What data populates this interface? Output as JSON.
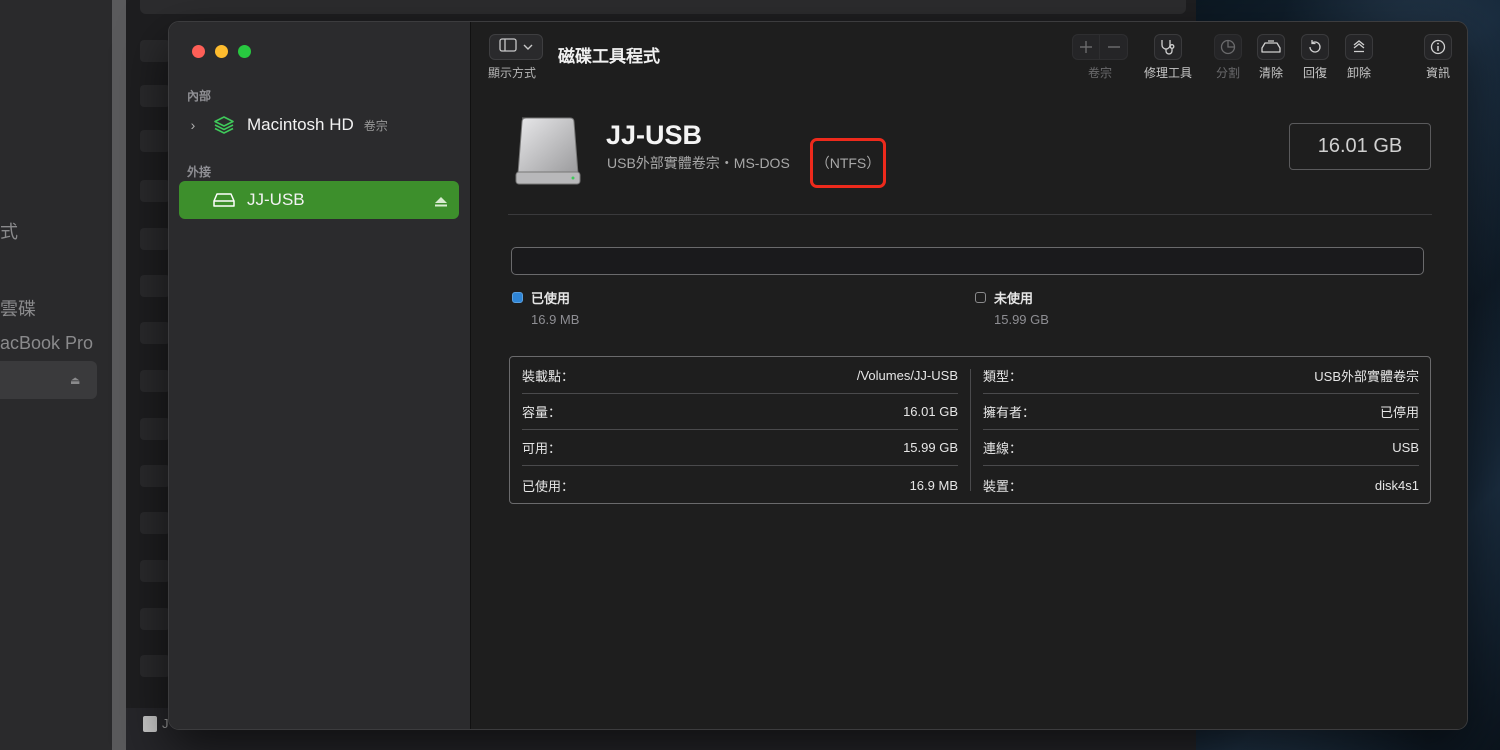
{
  "background": {
    "left_texts": [
      "式",
      "雲碟",
      "acBook Pro"
    ],
    "bottom_text": "J"
  },
  "window": {
    "title": "磁碟工具程式",
    "view_label": "顯示方式",
    "toolbar": {
      "volume": "卷宗",
      "first_aid": "修理工具",
      "partition": "分割",
      "erase": "清除",
      "restore": "回復",
      "unmount": "卸除",
      "info": "資訊"
    }
  },
  "sidebar": {
    "internal_header": "內部",
    "external_header": "外接",
    "items": [
      {
        "label": "Macintosh HD",
        "sub": "卷宗"
      },
      {
        "label": "JJ-USB",
        "sub": ""
      }
    ]
  },
  "volume": {
    "name": "JJ-USB",
    "description": "USB外部實體卷宗・MS-DOS",
    "filesystem": "（NTFS）",
    "capacity": "16.01 GB"
  },
  "usage": {
    "used_label": "已使用",
    "used_value": "16.9 MB",
    "free_label": "未使用",
    "free_value": "15.99 GB",
    "used_fraction": 0.001,
    "colors": {
      "used": "#2f85d6",
      "accent": "#3d8f2c",
      "highlight": "#ee2a1c"
    }
  },
  "info": {
    "left": [
      {
        "key": "裝載點：",
        "value": "/Volumes/JJ-USB"
      },
      {
        "key": "容量：",
        "value": "16.01 GB"
      },
      {
        "key": "可用：",
        "value": "15.99 GB"
      },
      {
        "key": "已使用：",
        "value": "16.9 MB"
      }
    ],
    "right": [
      {
        "key": "類型：",
        "value": "USB外部實體卷宗"
      },
      {
        "key": "擁有者：",
        "value": "已停用"
      },
      {
        "key": "連線：",
        "value": "USB"
      },
      {
        "key": "裝置：",
        "value": "disk4s1"
      }
    ]
  }
}
